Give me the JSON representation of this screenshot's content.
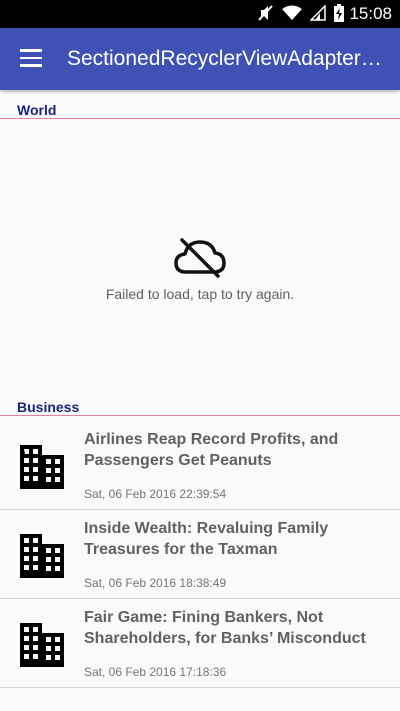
{
  "status_bar": {
    "time": "15:08",
    "icons": [
      "mute-icon",
      "wifi-icon",
      "signal-icon",
      "battery-charging-icon"
    ]
  },
  "app_bar": {
    "title": "SectionedRecyclerViewAdapter…",
    "color": "#3f51b5"
  },
  "sections": [
    {
      "header": "World",
      "error": {
        "icon": "cloud-off-icon",
        "message": "Failed to load, tap to try again."
      }
    },
    {
      "header": "Business",
      "items": [
        {
          "icon": "building-icon",
          "title": "Airlines Reap Record Profits, and Passengers Get Peanuts",
          "date": "Sat, 06 Feb 2016 22:39:54"
        },
        {
          "icon": "building-icon",
          "title": "Inside Wealth: Revaluing Family Treasures for the Taxman",
          "date": "Sat, 06 Feb 2016 18:38:49"
        },
        {
          "icon": "building-icon",
          "title": "Fair Game: Fining Bankers, Not Shareholders, for Banks’ Misconduct",
          "date": "Sat, 06 Feb 2016 17:18:36"
        }
      ]
    }
  ]
}
